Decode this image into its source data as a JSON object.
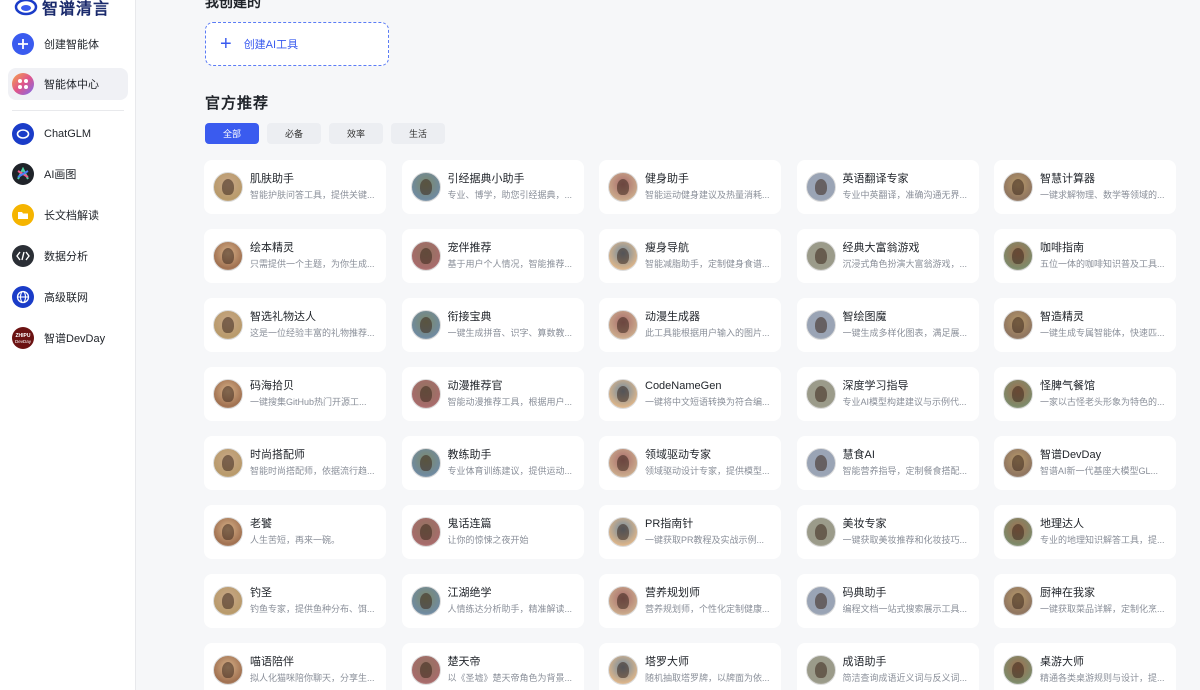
{
  "app": {
    "logo_text": "智谱清言"
  },
  "sidebar": {
    "items": [
      {
        "label": "创建智能体",
        "icon": "plus-icon",
        "color": "#3a5bef"
      },
      {
        "label": "智能体中心",
        "icon": "apps-icon",
        "color": "#f28c38"
      },
      {
        "label": "ChatGLM",
        "icon": "chatglm-logo-icon",
        "color": "#1a3cc8"
      },
      {
        "label": "AI画图",
        "icon": "ai-draw-icon",
        "color": "#1f2329"
      },
      {
        "label": "长文档解读",
        "icon": "folder-icon",
        "color": "#f5b400"
      },
      {
        "label": "数据分析",
        "icon": "code-icon",
        "color": "#2b2f36"
      },
      {
        "label": "高级联网",
        "icon": "globe-icon",
        "color": "#1a3cc8"
      },
      {
        "label": "智谱DevDay",
        "icon": "devday-icon",
        "color": "#6b1212"
      }
    ]
  },
  "main": {
    "my_created_title": "我创建的",
    "create_tool_label": "创建AI工具",
    "official_title": "官方推荐",
    "filters": [
      "全部",
      "必备",
      "效率",
      "生活"
    ],
    "active_filter": "全部",
    "agents": [
      {
        "title": "肌肤助手",
        "desc": "智能护肤问答工具，提供关键..."
      },
      {
        "title": "引经据典小助手",
        "desc": "专业、博学，助您引经据典，..."
      },
      {
        "title": "健身助手",
        "desc": "智能运动健身建议及热量消耗..."
      },
      {
        "title": "英语翻译专家",
        "desc": "专业中英翻译，准确沟通无界..."
      },
      {
        "title": "智慧计算器",
        "desc": "一键求解物理、数学等领域的..."
      },
      {
        "title": "绘本精灵",
        "desc": "只需提供一个主题，为你生成..."
      },
      {
        "title": "宠伴推荐",
        "desc": "基于用户个人情况，智能推荐..."
      },
      {
        "title": "瘦身导航",
        "desc": "智能减脂助手，定制健身食谱..."
      },
      {
        "title": "经典大富翁游戏",
        "desc": "沉浸式角色扮演大富翁游戏，..."
      },
      {
        "title": "咖啡指南",
        "desc": "五位一体的咖啡知识普及工具..."
      },
      {
        "title": "智选礼物达人",
        "desc": "这是一位经验丰富的礼物推荐..."
      },
      {
        "title": "衔接宝典",
        "desc": "一键生成拼音、识字、算数教..."
      },
      {
        "title": "动漫生成器",
        "desc": "此工具能根据用户输入的图片..."
      },
      {
        "title": "智绘图魔",
        "desc": "一键生成多样化图表，满足展..."
      },
      {
        "title": "智造精灵",
        "desc": "一键生成专属智能体，快速匹..."
      },
      {
        "title": "码海拾贝",
        "desc": "一键搜集GitHub热门开源工..."
      },
      {
        "title": "动漫推荐官",
        "desc": "智能动漫推荐工具，根据用户..."
      },
      {
        "title": "CodeNameGen",
        "desc": "一键将中文短语转换为符合编..."
      },
      {
        "title": "深度学习指导",
        "desc": "专业AI模型构建建议与示例代..."
      },
      {
        "title": "怪脾气餐馆",
        "desc": "一家以古怪老头形象为特色的..."
      },
      {
        "title": "时尚搭配师",
        "desc": "智能时尚搭配师，依据流行趋..."
      },
      {
        "title": "教练助手",
        "desc": "专业体育训练建议，提供运动..."
      },
      {
        "title": "领域驱动专家",
        "desc": "领域驱动设计专家，提供模型..."
      },
      {
        "title": "慧食AI",
        "desc": "智能营养指导，定制餐食搭配..."
      },
      {
        "title": "智谱DevDay",
        "desc": "智谱AI新一代基座大模型GL..."
      },
      {
        "title": "老饕",
        "desc": "人生苦短，再来一碗。"
      },
      {
        "title": "鬼话连篇",
        "desc": "让你的惊悚之夜开始"
      },
      {
        "title": "PR指南针",
        "desc": "一键获取PR教程及实战示例..."
      },
      {
        "title": "美妆专家",
        "desc": "一键获取美妆推荐和化妆技巧..."
      },
      {
        "title": "地理达人",
        "desc": "专业的地理知识解答工具，提..."
      },
      {
        "title": "钓圣",
        "desc": "钓鱼专家，提供鱼种分布、饵..."
      },
      {
        "title": "江湖绝学",
        "desc": "人情练达分析助手，精准解读..."
      },
      {
        "title": "营养规划师",
        "desc": "营养规划师，个性化定制健康..."
      },
      {
        "title": "码典助手",
        "desc": "编程文档一站式搜索展示工具..."
      },
      {
        "title": "厨神在我家",
        "desc": "一键获取菜品详解，定制化烹..."
      },
      {
        "title": "喵语陪伴",
        "desc": "拟人化猫咪陪你聊天，分享生..."
      },
      {
        "title": "楚天帝",
        "desc": "以《圣墟》楚天帝角色为背景..."
      },
      {
        "title": "塔罗大师",
        "desc": "随机抽取塔罗牌，以牌面为依..."
      },
      {
        "title": "成语助手",
        "desc": "简洁查询成语近义词与反义词..."
      },
      {
        "title": "桌游大师",
        "desc": "精通各类桌游规则与设计，提..."
      }
    ]
  }
}
